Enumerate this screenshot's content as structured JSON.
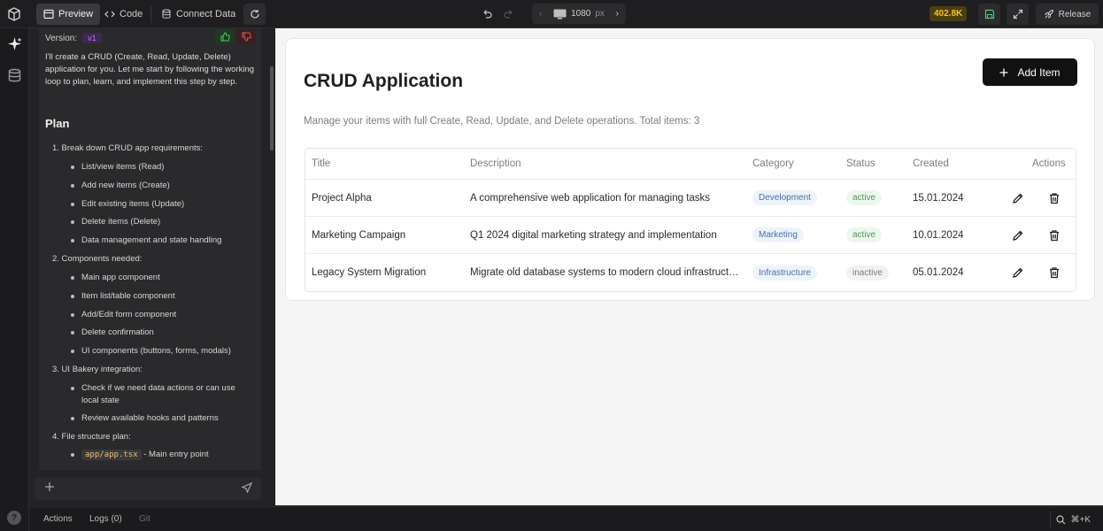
{
  "toolbar": {
    "preview_label": "Preview",
    "code_label": "Code",
    "connect_label": "Connect Data",
    "device_width": "1080",
    "device_unit": "px",
    "credits": "402.8K",
    "release_label": "Release"
  },
  "chat": {
    "version_label": "Version:",
    "version_value": "v1",
    "intro": "I'll create a CRUD (Create, Read, Update, Delete) application for you. Let me start by following the working loop to plan, learn, and implement this step by step.",
    "plan_heading": "Plan",
    "steps": [
      {
        "label": "1.  Break down CRUD app requirements:",
        "items": [
          "List/view items (Read)",
          "Add new items (Create)",
          "Edit existing items (Update)",
          "Delete items (Delete)",
          "Data management and state handling"
        ]
      },
      {
        "label": "2.  Components needed:",
        "items": [
          "Main app component",
          "Item list/table component",
          "Add/Edit form component",
          "Delete confirmation",
          "UI components (buttons, forms, modals)"
        ]
      },
      {
        "label": "3.  UI Bakery integration:",
        "items": [
          "Check if we need data actions or can use",
          "local state",
          "Review available hooks and patterns"
        ]
      },
      {
        "label": "4.  File structure plan:",
        "items": []
      }
    ],
    "file_code": "app/app.tsx",
    "file_desc": " - Main entry point"
  },
  "bottom": {
    "actions_label": "Actions",
    "logs_label": "Logs (0)",
    "git_label": "Git",
    "shortcut": "⌘+K"
  },
  "app": {
    "title": "CRUD Application",
    "add_label": "Add Item",
    "subtitle": "Manage your items with full Create, Read, Update, and Delete operations. Total items: 3",
    "columns": [
      "Title",
      "Description",
      "Category",
      "Status",
      "Created",
      "Actions"
    ],
    "rows": [
      {
        "title": "Project Alpha",
        "description": "A comprehensive web application for managing tasks",
        "category": "Development",
        "status": "active",
        "created": "15.01.2024"
      },
      {
        "title": "Marketing Campaign",
        "description": "Q1 2024 digital marketing strategy and implementation",
        "category": "Marketing",
        "status": "active",
        "created": "10.01.2024"
      },
      {
        "title": "Legacy System Migration",
        "description": "Migrate old database systems to modern cloud infrastructure",
        "category": "Infrastructure",
        "status": "inactive",
        "created": "05.01.2024"
      }
    ]
  },
  "colors": {
    "accent_purple": "#c07ce8",
    "credits_yellow": "#f2c230",
    "status_active": "#4d9a57",
    "category_blue": "#4b6ea8"
  }
}
